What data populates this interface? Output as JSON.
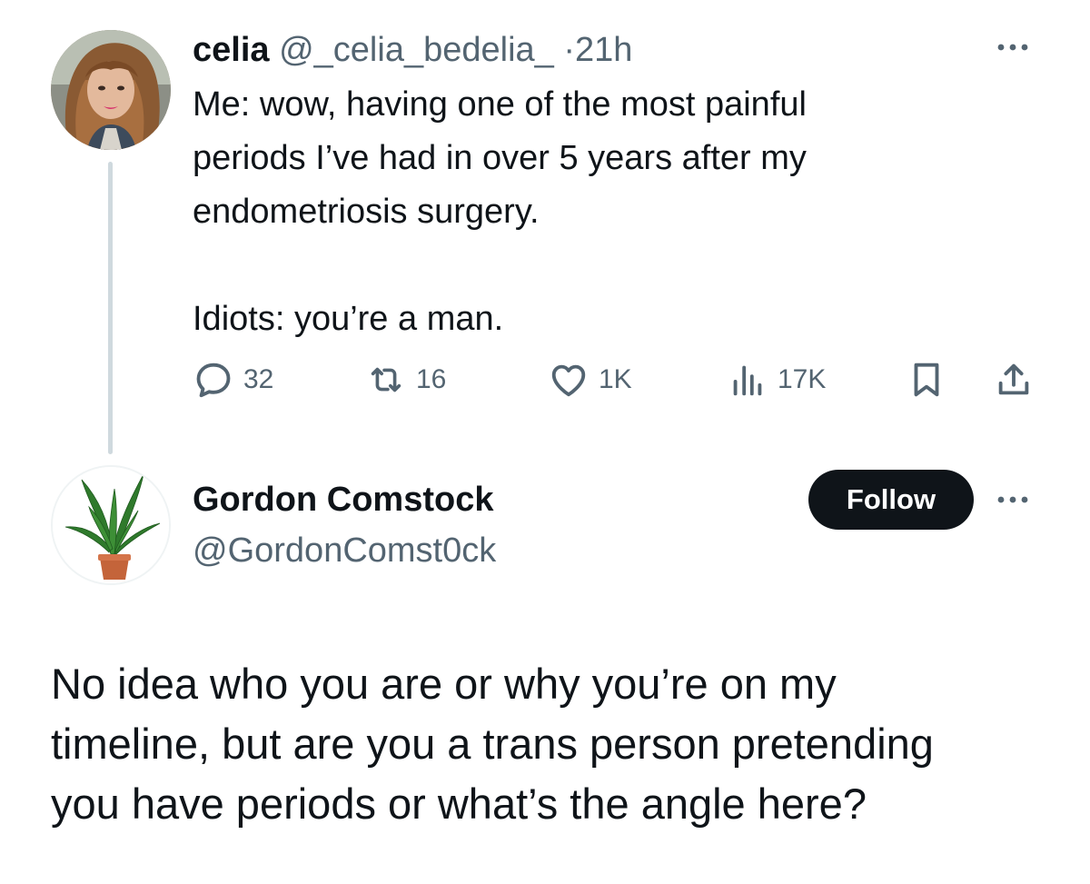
{
  "tweet1": {
    "author": {
      "name": "celia",
      "handle": "@_celia_bedelia_",
      "separator": "·",
      "time": "21h"
    },
    "body_lines": [
      "Me: wow, having one of the most painful",
      "periods I’ve had in over 5 years after my",
      "endometriosis surgery.",
      "",
      "Idiots: you’re a man."
    ],
    "actions": {
      "reply": {
        "icon": "reply-icon",
        "count": "32"
      },
      "retweet": {
        "icon": "retweet-icon",
        "count": "16"
      },
      "like": {
        "icon": "heart-icon",
        "count": "1K"
      },
      "views": {
        "icon": "views-icon",
        "count": "17K"
      },
      "bookmark": {
        "icon": "bookmark-icon"
      },
      "share": {
        "icon": "share-icon"
      }
    },
    "more_icon": "more-horizontal-icon"
  },
  "tweet2": {
    "author": {
      "name": "Gordon Comstock",
      "handle": "@GordonComst0ck"
    },
    "follow_label": "Follow",
    "more_icon": "more-horizontal-icon",
    "body_lines": [
      "No idea who you are or why you’re on my",
      "timeline, but are you a trans person pretending",
      "you have periods or what’s the angle here?"
    ]
  },
  "colors": {
    "text_primary": "#0f1419",
    "text_secondary": "#536471",
    "thread_line": "#cfd9de",
    "follow_button_bg": "#0f1419",
    "follow_button_text": "#ffffff"
  }
}
